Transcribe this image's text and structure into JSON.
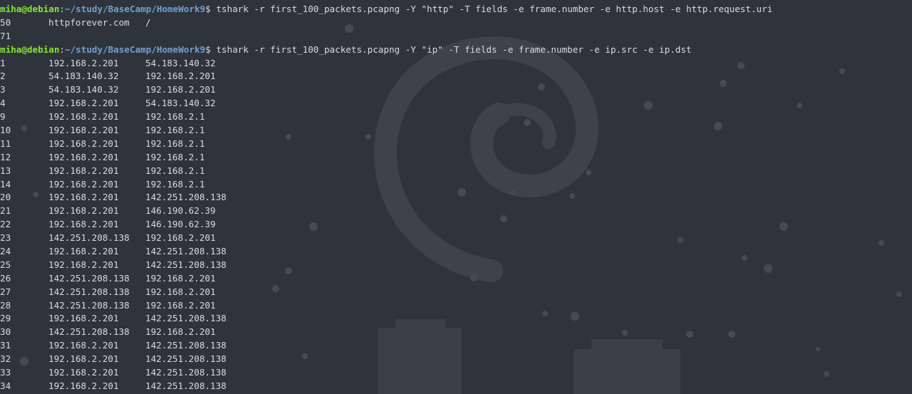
{
  "commands": [
    {
      "user": "miha@debian",
      "separator": ":",
      "path": "~/study/BaseCamp/HomeWork9",
      "symbol": "$",
      "command": "tshark -r first_100_packets.pcapng -Y \"http\" -T fields -e frame.number -e http.host -e http.request.uri",
      "rows": [
        [
          "50",
          "httpforever.com",
          "/"
        ],
        [
          "71",
          "",
          ""
        ]
      ]
    },
    {
      "user": "miha@debian",
      "separator": ":",
      "path": "~/study/BaseCamp/HomeWork9",
      "symbol": "$",
      "command": "tshark -r first_100_packets.pcapng -Y \"ip\" -T fields -e frame.number -e ip.src -e ip.dst",
      "rows": [
        [
          "1",
          "192.168.2.201",
          "54.183.140.32"
        ],
        [
          "2",
          "54.183.140.32",
          "192.168.2.201"
        ],
        [
          "3",
          "54.183.140.32",
          "192.168.2.201"
        ],
        [
          "4",
          "192.168.2.201",
          "54.183.140.32"
        ],
        [
          "9",
          "192.168.2.201",
          "192.168.2.1"
        ],
        [
          "10",
          "192.168.2.201",
          "192.168.2.1"
        ],
        [
          "11",
          "192.168.2.201",
          "192.168.2.1"
        ],
        [
          "12",
          "192.168.2.201",
          "192.168.2.1"
        ],
        [
          "13",
          "192.168.2.201",
          "192.168.2.1"
        ],
        [
          "14",
          "192.168.2.201",
          "192.168.2.1"
        ],
        [
          "20",
          "192.168.2.201",
          "142.251.208.138"
        ],
        [
          "21",
          "192.168.2.201",
          "146.190.62.39"
        ],
        [
          "22",
          "192.168.2.201",
          "146.190.62.39"
        ],
        [
          "23",
          "142.251.208.138",
          "192.168.2.201"
        ],
        [
          "24",
          "192.168.2.201",
          "142.251.208.138"
        ],
        [
          "25",
          "192.168.2.201",
          "142.251.208.138"
        ],
        [
          "26",
          "142.251.208.138",
          "192.168.2.201"
        ],
        [
          "27",
          "142.251.208.138",
          "192.168.2.201"
        ],
        [
          "28",
          "142.251.208.138",
          "192.168.2.201"
        ],
        [
          "29",
          "192.168.2.201",
          "142.251.208.138"
        ],
        [
          "30",
          "142.251.208.138",
          "192.168.2.201"
        ],
        [
          "31",
          "192.168.2.201",
          "142.251.208.138"
        ],
        [
          "32",
          "192.168.2.201",
          "142.251.208.138"
        ],
        [
          "33",
          "192.168.2.201",
          "142.251.208.138"
        ],
        [
          "34",
          "192.168.2.201",
          "142.251.208.138"
        ]
      ]
    }
  ],
  "colors": {
    "background": "#2f343c",
    "prompt_user": "#8ae234",
    "prompt_path": "#729fcf",
    "text": "#d7dbe0"
  },
  "background_art": "debian-swirl-logo-with-stars-and-city"
}
